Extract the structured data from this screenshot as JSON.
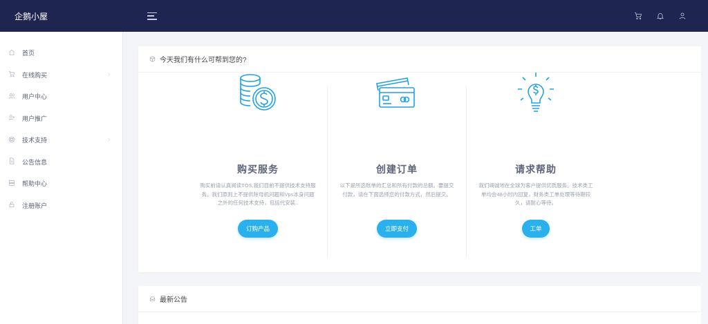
{
  "app": {
    "brand": "企鹅小屋"
  },
  "sidebar": {
    "items": [
      {
        "label": "首页",
        "icon": "home-icon",
        "has_submenu": false
      },
      {
        "label": "在线购买",
        "icon": "cart-icon",
        "has_submenu": true
      },
      {
        "label": "用户中心",
        "icon": "users-icon",
        "has_submenu": false
      },
      {
        "label": "用户推广",
        "icon": "user-plus-icon",
        "has_submenu": false
      },
      {
        "label": "技术支持",
        "icon": "support-icon",
        "has_submenu": true
      },
      {
        "label": "公告信息",
        "icon": "file-icon",
        "has_submenu": false
      },
      {
        "label": "帮助中心",
        "icon": "server-icon",
        "has_submenu": false
      },
      {
        "label": "注册账户",
        "icon": "lock-icon",
        "has_submenu": false
      }
    ]
  },
  "main": {
    "help_card": {
      "title": "今天我们有什么可帮到您的?",
      "columns": [
        {
          "title": "购买服务",
          "description": "购买前请认真阅读TOS,我们目前不提供技术支持服务。我们原则上不提供除母机问题和Vps本身问题之外的任何技术支持，包括代安装..",
          "button": "订购产品",
          "icon": "coins-dollar-icon"
        },
        {
          "title": "创建订单",
          "description": "以下是所选账单的汇总和所有付款的总额。要提交付款，请在下面选择您的付款方式，然后提交。",
          "button": "立即支付",
          "icon": "credit-cards-icon"
        },
        {
          "title": "请求帮助",
          "description": "我们竭诚地在全球为客户提供优质服务。技术类工单均会48小时内回复，财务类工单处理等待期较久，请耐心等待。",
          "button": "工单",
          "icon": "lightbulb-dollar-icon"
        }
      ]
    },
    "news_card": {
      "title": "最新公告"
    }
  },
  "colors": {
    "topbar": "#1e2550",
    "accent": "#2bb0ee",
    "icon_blue": "#1ea1e8"
  }
}
